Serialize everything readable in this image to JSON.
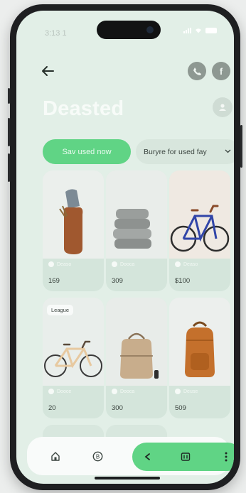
{
  "status_bar": {
    "time": "3:13 1"
  },
  "header": {
    "title": "Deasted"
  },
  "filters": {
    "primary_label": "Sav used now",
    "select_label": "Buryre for used fay"
  },
  "products": [
    {
      "image": "vase-with-towel",
      "meta": "Deaso",
      "price": "169",
      "badge": ""
    },
    {
      "image": "folded-towels",
      "meta": "Dooca",
      "price": "309",
      "badge": ""
    },
    {
      "image": "blue-bicycle",
      "meta": "Deaso",
      "price": "$100",
      "badge": ""
    },
    {
      "image": "cream-bicycle",
      "meta": "Dooce",
      "price": "20",
      "badge": "League"
    },
    {
      "image": "canvas-tote-bag",
      "meta": "Dooca",
      "price": "300",
      "badge": ""
    },
    {
      "image": "orange-backpack",
      "meta": "Deuse",
      "price": "509",
      "badge": ""
    }
  ],
  "bottom_nav": {
    "icons": [
      "home-icon",
      "profile-badge-icon"
    ],
    "actions": [
      "back-chevron-icon",
      "scan-icon",
      "more-vertical-icon"
    ]
  },
  "header_icons": [
    "phone-icon",
    "facebook-icon",
    "profile-icon"
  ],
  "colors": {
    "accent": "#60d485",
    "background": "#e2efe7",
    "card": "#d4e5db"
  }
}
